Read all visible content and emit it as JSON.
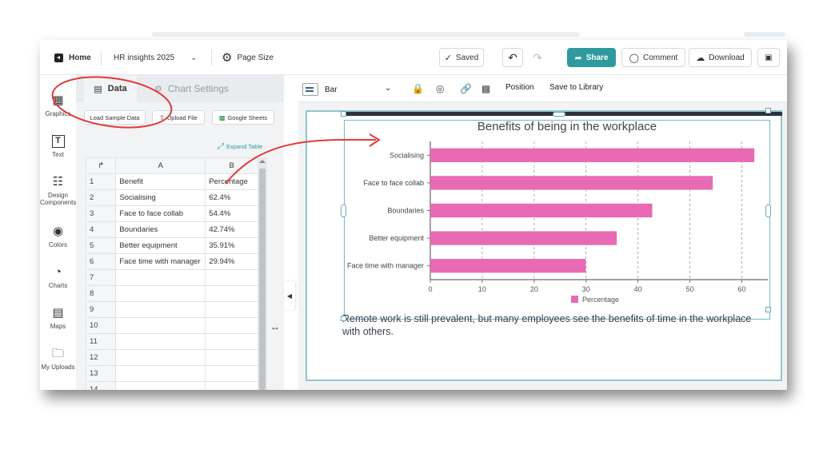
{
  "header": {
    "home_label": "Home",
    "project_name": "HR insights 2025",
    "page_size_label": "Page Size",
    "saved_label": "Saved",
    "share_label": "Share",
    "comment_label": "Comment",
    "download_label": "Download"
  },
  "sidebar": {
    "items": [
      {
        "label": "Graphics",
        "icon": "graphics-icon"
      },
      {
        "label": "Text",
        "icon": "text-icon"
      },
      {
        "label": "Design Components",
        "icon": "design-components-icon"
      },
      {
        "label": "Colors",
        "icon": "palette-icon"
      },
      {
        "label": "Charts",
        "icon": "charts-icon"
      },
      {
        "label": "Maps",
        "icon": "map-icon"
      },
      {
        "label": "My Uploads",
        "icon": "folder-icon"
      }
    ]
  },
  "panel": {
    "tabs": [
      {
        "label": "Data"
      },
      {
        "label": "Chart Settings"
      }
    ],
    "load_sample": "Load Sample Data",
    "upload_file": "Upload File",
    "google_sheets": "Google Sheets",
    "expand_table": "Expand Table",
    "columns": [
      "A",
      "B"
    ],
    "rows": [
      {
        "n": "1",
        "a": "Benefit",
        "b": "Percentage"
      },
      {
        "n": "2",
        "a": "Socialising",
        "b": "62.4%"
      },
      {
        "n": "3",
        "a": "Face to face collab",
        "b": "54.4%"
      },
      {
        "n": "4",
        "a": "Boundaries",
        "b": "42.74%"
      },
      {
        "n": "5",
        "a": "Better equipment",
        "b": "35.91%"
      },
      {
        "n": "6",
        "a": "Face time with manager",
        "b": "29.94%"
      },
      {
        "n": "7",
        "a": "",
        "b": ""
      },
      {
        "n": "8",
        "a": "",
        "b": ""
      },
      {
        "n": "9",
        "a": "",
        "b": ""
      },
      {
        "n": "10",
        "a": "",
        "b": ""
      },
      {
        "n": "11",
        "a": "",
        "b": ""
      },
      {
        "n": "12",
        "a": "",
        "b": ""
      },
      {
        "n": "13",
        "a": "",
        "b": ""
      },
      {
        "n": "14",
        "a": "",
        "b": ""
      }
    ]
  },
  "canvas_toolbar": {
    "chart_type": "Bar",
    "position_label": "Position",
    "save_library_label": "Save to Library"
  },
  "chart_data": {
    "type": "bar",
    "orientation": "horizontal",
    "title": "Benefits of being in the workplace",
    "categories": [
      "Socialising",
      "Face to face collab",
      "Boundaries",
      "Better equipment",
      "Face time with manager"
    ],
    "series": [
      {
        "name": "Percentage",
        "values": [
          62.4,
          54.4,
          42.74,
          35.91,
          29.94
        ],
        "color": "#e86ab5"
      }
    ],
    "xlim": [
      0,
      65
    ],
    "xticks": [
      "0",
      "10",
      "20",
      "30",
      "40",
      "50",
      "60"
    ],
    "grid": "vertical dashed",
    "legend": "bottom"
  },
  "caption": "Remote work is still prevalent, but many employees see the benefits of time in the workplace with others.",
  "colors": {
    "accent": "#2f9a9e",
    "annotation": "#e03a3a"
  }
}
